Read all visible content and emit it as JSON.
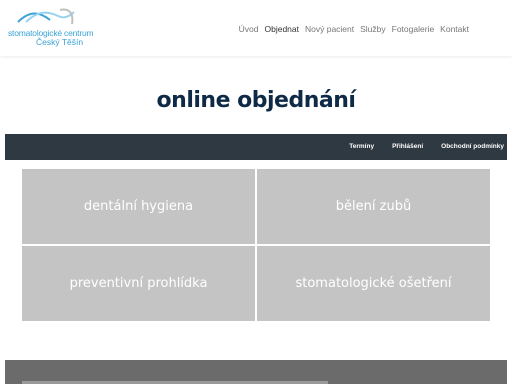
{
  "logo": {
    "line1": "stomatologické centrum",
    "line2": "Český Těšín"
  },
  "nav": {
    "items": [
      "Úvod",
      "Objednat",
      "Nový pacient",
      "Služby",
      "Fotogalerie",
      "Kontakt"
    ],
    "active": "Objednat"
  },
  "page": {
    "title": "online objednání"
  },
  "subnav": {
    "items": [
      "Termíny",
      "Přihlášení",
      "Obchodní podmínky"
    ]
  },
  "tiles": [
    "dentální hygiena",
    "bělení zubů",
    "preventivní prohlídka",
    "stomatologické ošetření"
  ],
  "colors": {
    "brand": "#3aa3d6",
    "title": "#0e2a47",
    "subbar": "#2f3942",
    "tile": "#c4c4c4"
  }
}
